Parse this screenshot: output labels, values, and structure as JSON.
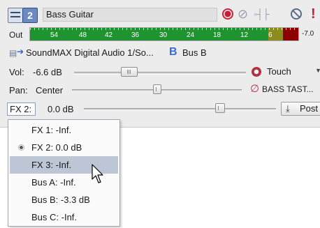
{
  "track": {
    "name": "Bass Guitar",
    "number": "2",
    "icons": [
      "track-icon",
      "record-icon",
      "phase-invert-icon",
      "fx-chain-icon",
      "mute-icon",
      "solo-icon"
    ],
    "solo_glyph": "!"
  },
  "meter": {
    "label": "Out",
    "scale": [
      "54",
      "48",
      "42",
      "36",
      "30",
      "24",
      "18",
      "12",
      "6"
    ],
    "peak": "-7.0",
    "colors": {
      "normal": "#1f9330",
      "warn": "#8b8b1e",
      "clip": "#8c0000"
    }
  },
  "output": {
    "device": "SoundMAX Digital Audio 1/So...",
    "bus_letter": "B",
    "bus_name": "Bus B"
  },
  "volume": {
    "label": "Vol:",
    "value": "-6.6 dB",
    "level": 0.3
  },
  "pan": {
    "label": "Pan:",
    "value": "Center",
    "level": 0.5
  },
  "automation": {
    "label": "Touch"
  },
  "pan_plugin": {
    "label": "BASS TAST..."
  },
  "send": {
    "selected": "FX 2:",
    "value": "0.0 dB",
    "level": 0.72,
    "post_label": "Post"
  },
  "menu": {
    "items": [
      {
        "label": "FX 1: -Inf."
      },
      {
        "label": "FX 2: 0.0 dB",
        "checked": true
      },
      {
        "label": "FX 3: -Inf.",
        "hover": true
      },
      {
        "label": "Bus A: -Inf."
      },
      {
        "label": "Bus B: -3.3 dB"
      },
      {
        "label": "Bus C: -Inf."
      }
    ]
  }
}
